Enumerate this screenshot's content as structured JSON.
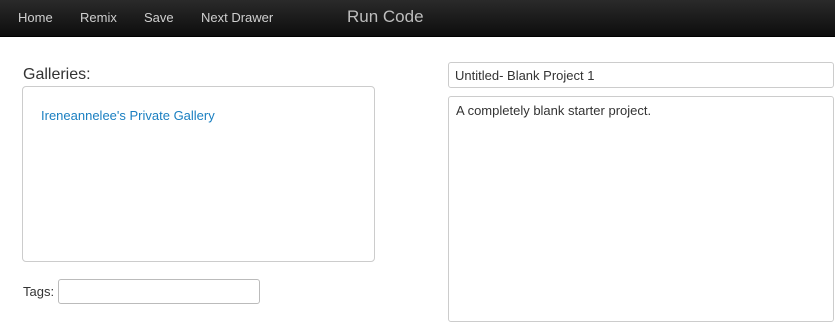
{
  "navbar": {
    "items": [
      {
        "label": "Home"
      },
      {
        "label": "Remix"
      },
      {
        "label": "Save"
      },
      {
        "label": "Next Drawer"
      }
    ],
    "run_code_label": "Run Code"
  },
  "galleries": {
    "label": "Galleries:",
    "items": [
      {
        "label": "Ireneannelee's Private Gallery"
      }
    ]
  },
  "tags": {
    "label": "Tags:",
    "value": ""
  },
  "project": {
    "title": "Untitled- Blank Project 1",
    "description": "A completely blank starter project."
  },
  "colors": {
    "navbar_bg": "#1a1a1a",
    "link": "#1a7fc1",
    "border": "#cccccc"
  }
}
